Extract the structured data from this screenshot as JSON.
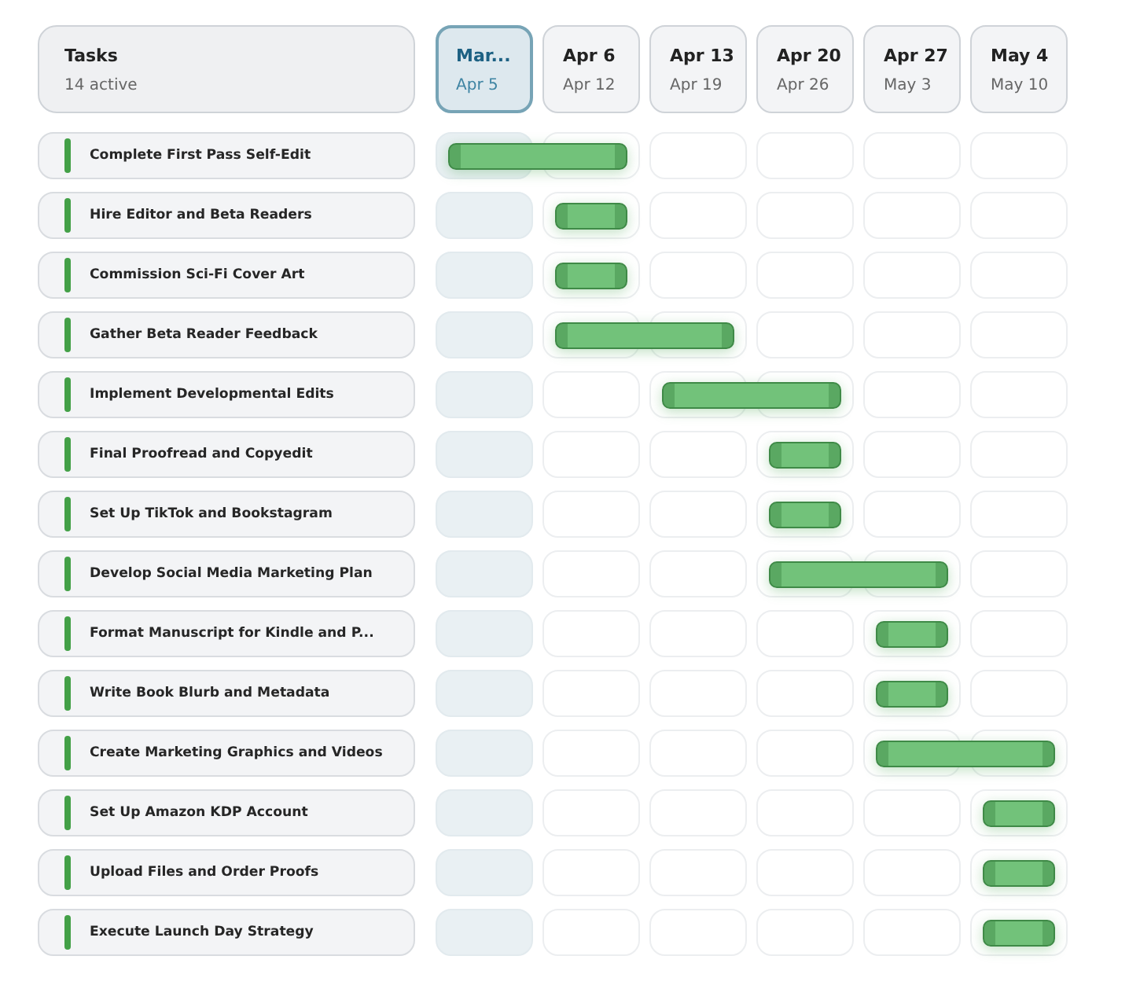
{
  "header": {
    "title": "Tasks",
    "subtitle": "14 active"
  },
  "weeks": [
    {
      "title": "Mar...",
      "subtitle": "Apr 5",
      "selected": true
    },
    {
      "title": "Apr 6",
      "subtitle": "Apr 12",
      "selected": false
    },
    {
      "title": "Apr 13",
      "subtitle": "Apr 19",
      "selected": false
    },
    {
      "title": "Apr 20",
      "subtitle": "Apr 26",
      "selected": false
    },
    {
      "title": "Apr 27",
      "subtitle": "May 3",
      "selected": false
    },
    {
      "title": "May 4",
      "subtitle": "May 10",
      "selected": false
    }
  ],
  "tasks": [
    {
      "name": "Complete First Pass Self-Edit",
      "scheduled": [
        true,
        true,
        false,
        false,
        false,
        false
      ]
    },
    {
      "name": "Hire Editor and Beta Readers",
      "scheduled": [
        false,
        true,
        false,
        false,
        false,
        false
      ]
    },
    {
      "name": "Commission Sci-Fi Cover Art",
      "scheduled": [
        false,
        true,
        false,
        false,
        false,
        false
      ]
    },
    {
      "name": "Gather Beta Reader Feedback",
      "scheduled": [
        false,
        true,
        true,
        false,
        false,
        false
      ]
    },
    {
      "name": "Implement Developmental Edits",
      "scheduled": [
        false,
        false,
        true,
        true,
        false,
        false
      ]
    },
    {
      "name": "Final Proofread and Copyedit",
      "scheduled": [
        false,
        false,
        false,
        true,
        false,
        false
      ]
    },
    {
      "name": "Set Up TikTok and Bookstagram",
      "scheduled": [
        false,
        false,
        false,
        true,
        false,
        false
      ]
    },
    {
      "name": "Develop Social Media Marketing Plan",
      "scheduled": [
        false,
        false,
        false,
        true,
        true,
        false
      ]
    },
    {
      "name": "Format Manuscript for Kindle and P...",
      "scheduled": [
        false,
        false,
        false,
        false,
        true,
        false
      ]
    },
    {
      "name": "Write Book Blurb and Metadata",
      "scheduled": [
        false,
        false,
        false,
        false,
        true,
        false
      ]
    },
    {
      "name": "Create Marketing Graphics and Videos",
      "scheduled": [
        false,
        false,
        false,
        false,
        true,
        true
      ]
    },
    {
      "name": "Set Up Amazon KDP Account",
      "scheduled": [
        false,
        false,
        false,
        false,
        false,
        true
      ]
    },
    {
      "name": "Upload Files and Order Proofs",
      "scheduled": [
        false,
        false,
        false,
        false,
        false,
        true
      ]
    },
    {
      "name": "Execute Launch Day Strategy",
      "scheduled": [
        false,
        false,
        false,
        false,
        false,
        true
      ]
    }
  ]
}
